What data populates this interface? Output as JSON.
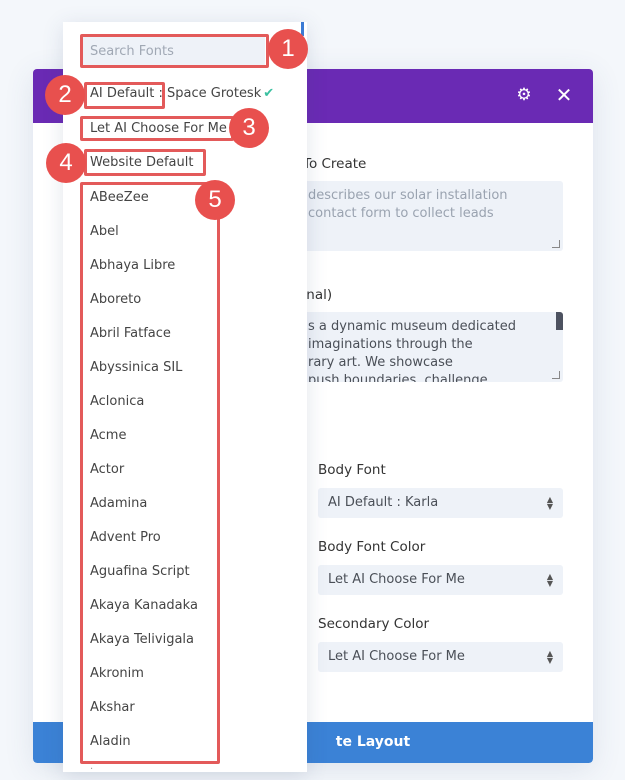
{
  "modal": {
    "header_color": "#6a2ab4",
    "icons": {
      "settings": "gear-icon",
      "close": "close-icon"
    },
    "settings_glyph": "⚙",
    "close_glyph": "✕",
    "fields": {
      "describe_label": "To Create",
      "describe_placeholder_line1": "describes our solar installation",
      "describe_placeholder_line2": "contact form to collect leads",
      "about_label": "onal)",
      "about_line1": "s a dynamic museum dedicated",
      "about_line2": " imaginations through the",
      "about_line3": "rary art. We showcase",
      "about_line4": "push boundaries, challenge"
    },
    "selects": [
      {
        "label": "Body Font",
        "value": "AI Default : Karla"
      },
      {
        "label": "Body Font Color",
        "value": "Let AI Choose For Me"
      },
      {
        "label": "Secondary Color",
        "value": "Let AI Choose For Me"
      }
    ],
    "generate_button": "te Layout",
    "button_color": "#3b82d6"
  },
  "dropdown": {
    "search_placeholder": "Search Fonts",
    "ai_default_prefix": "AI Default :",
    "ai_default_font": " Space Grotesk",
    "check_glyph": "✔",
    "let_ai_choose": "Let AI Choose For Me",
    "website_default": "Website Default",
    "fonts": [
      "ABeeZee",
      "Abel",
      "Abhaya Libre",
      "Aboreto",
      "Abril Fatface",
      "Abyssinica SIL",
      "Aclonica",
      "Acme",
      "Actor",
      "Adamina",
      "Advent Pro",
      "Aguafina Script",
      "Akaya Kanadaka",
      "Akaya Telivigala",
      "Akronim",
      "Akshar",
      "Aladin"
    ]
  },
  "annotations": {
    "color": "#e35a5a",
    "badges": [
      "1",
      "2",
      "3",
      "4",
      "5"
    ]
  }
}
